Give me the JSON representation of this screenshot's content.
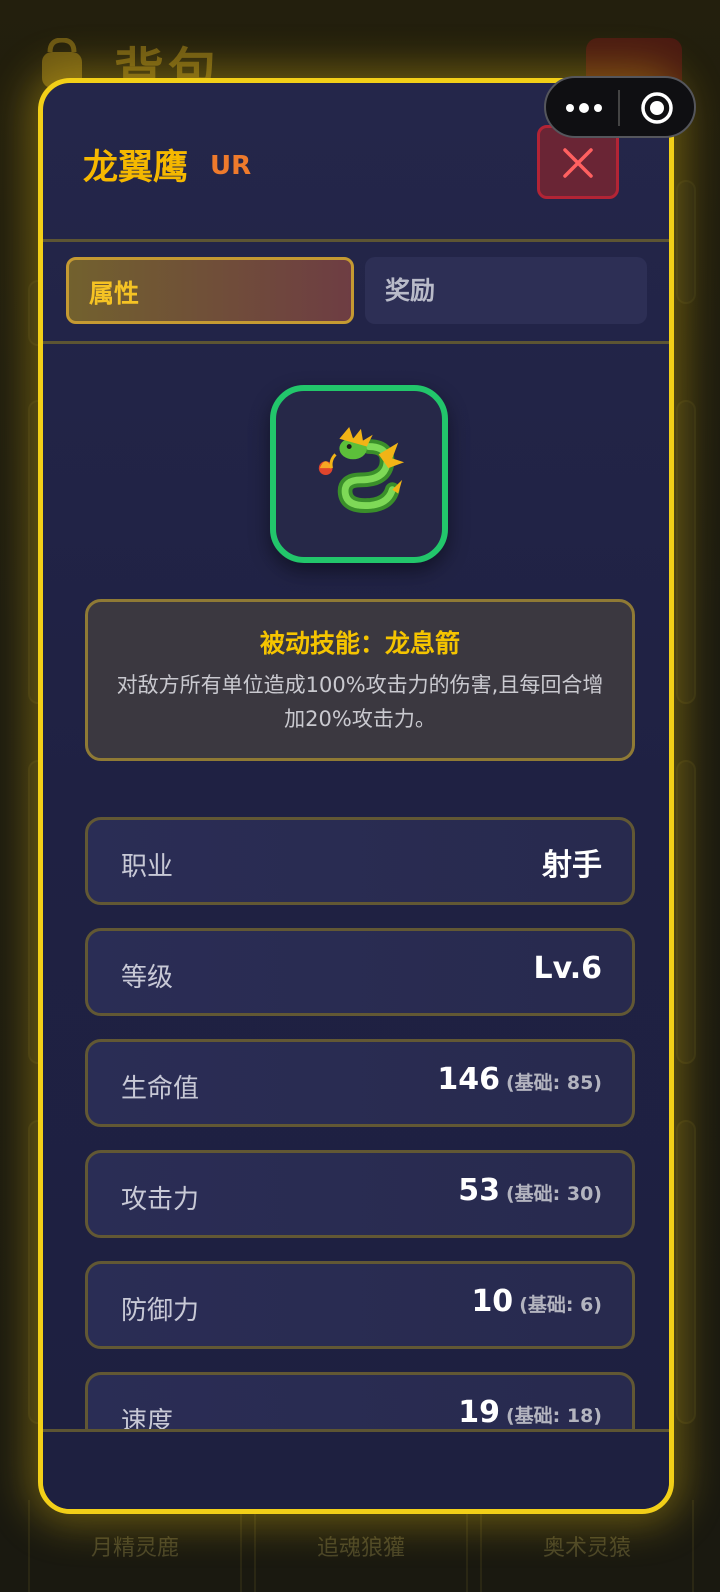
{
  "background": {
    "title": "背包",
    "bottom_items": [
      "月精灵鹿",
      "追魂狼獾",
      "奥术灵猿"
    ]
  },
  "modal": {
    "hero_name": "龙翼鹰",
    "rarity": "UR",
    "tabs": [
      {
        "label": "属性",
        "active": true
      },
      {
        "label": "奖励",
        "active": false
      }
    ],
    "avatar_icon": "dragon-icon",
    "skill": {
      "title": "被动技能：龙息箭",
      "description": "对敌方所有单位造成100%攻击力的伤害,且每回合增加20%攻击力。"
    },
    "stats": [
      {
        "label": "职业",
        "value": "射手",
        "base": ""
      },
      {
        "label": "等级",
        "value": "Lv.6",
        "base": ""
      },
      {
        "label": "生命值",
        "value": "146",
        "base": "(基础: 85)"
      },
      {
        "label": "攻击力",
        "value": "53",
        "base": "(基础: 30)"
      },
      {
        "label": "防御力",
        "value": "10",
        "base": "(基础: 6)"
      },
      {
        "label": "速度",
        "value": "19",
        "base": "(基础: 18)"
      }
    ]
  },
  "colors": {
    "modal_border": "#f2cf18",
    "hero_name": "#f5b800",
    "rarity": "#ee7a2c",
    "avatar_border": "#22c66b",
    "close_button": "#b22435"
  }
}
